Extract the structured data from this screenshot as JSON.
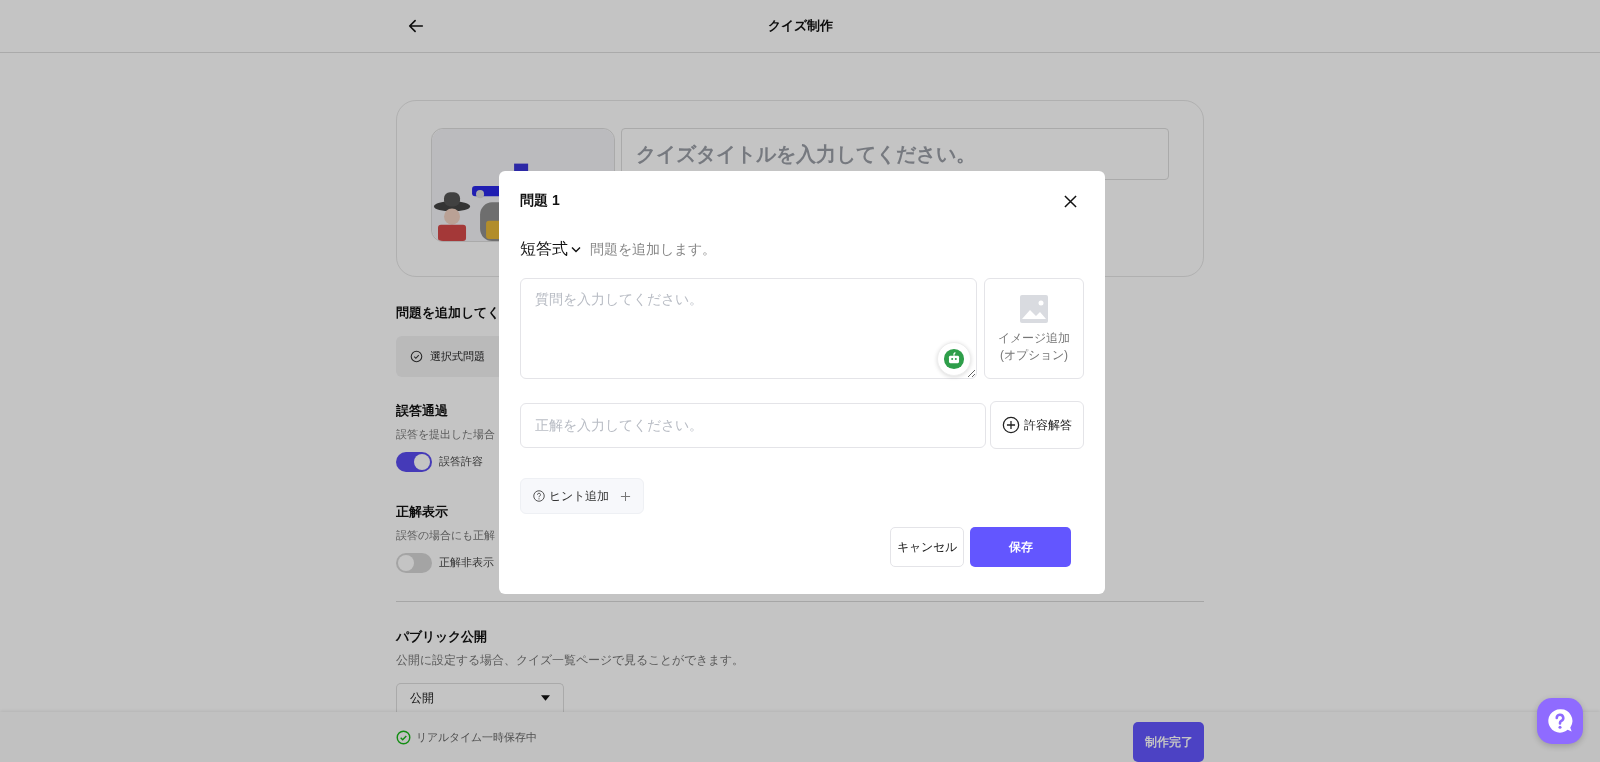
{
  "header": {
    "title": "クイズ制作"
  },
  "quiz_card": {
    "title_placeholder": "クイズタイトルを入力してください。"
  },
  "add_question": {
    "heading": "問題を追加してく",
    "types": [
      {
        "label": "選択式問題"
      }
    ]
  },
  "settings": [
    {
      "title": "誤答通過",
      "description": "誤答を提出した場合",
      "toggle": {
        "label": "誤答許容",
        "on": true
      }
    },
    {
      "title": "正解表示",
      "description": "誤答の場合にも正解",
      "toggle": {
        "label": "正解非表示",
        "on": false
      }
    }
  ],
  "public": {
    "title": "パブリック公開",
    "description": "公開に設定する場合、クイズ一覧ページで見ることができます。",
    "select": {
      "value": "公開"
    }
  },
  "status_bar": {
    "autosave": "リアルタイム一時保存中",
    "finish_button": "制作完了"
  },
  "modal": {
    "title": "問題 1",
    "type_select": "短答式",
    "subtitle": "問題を追加します。",
    "question_placeholder": "質問を入力してください。",
    "image_add": [
      "イメージ追加",
      "(オプション)"
    ],
    "answer_placeholder": "正解を入力してください。",
    "alt_answer_button": "許容解答",
    "hint_button": "ヒント追加",
    "cancel_button": "キャンセル",
    "save_button": "保存"
  }
}
